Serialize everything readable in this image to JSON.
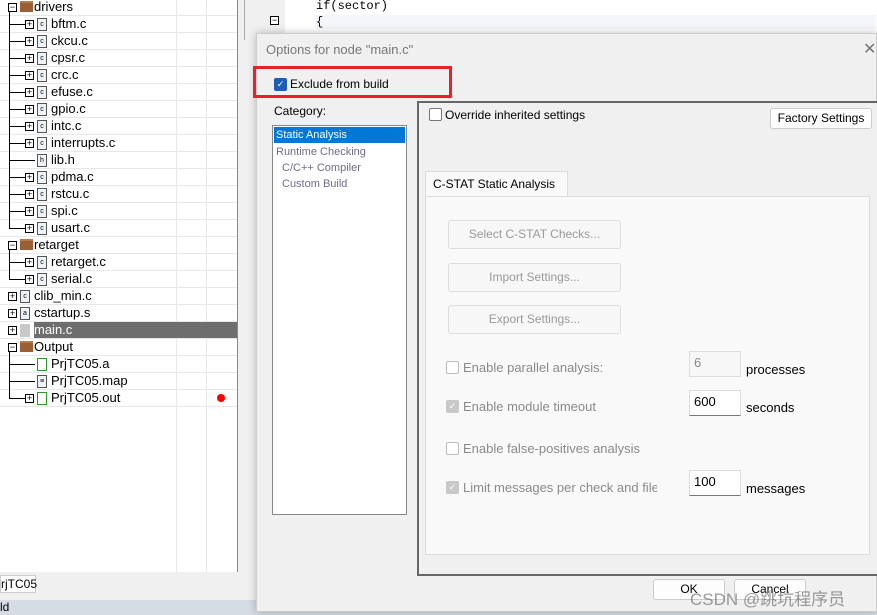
{
  "tree": {
    "items": [
      {
        "label": "drivers",
        "type": "folder",
        "level": 0,
        "expanded": true
      },
      {
        "label": "bftm.c",
        "type": "c",
        "level": 1
      },
      {
        "label": "ckcu.c",
        "type": "c",
        "level": 1
      },
      {
        "label": "cpsr.c",
        "type": "c",
        "level": 1
      },
      {
        "label": "crc.c",
        "type": "c",
        "level": 1
      },
      {
        "label": "efuse.c",
        "type": "c",
        "level": 1
      },
      {
        "label": "gpio.c",
        "type": "c",
        "level": 1
      },
      {
        "label": "intc.c",
        "type": "c",
        "level": 1
      },
      {
        "label": "interrupts.c",
        "type": "c",
        "level": 1
      },
      {
        "label": "lib.h",
        "type": "h",
        "level": 1
      },
      {
        "label": "pdma.c",
        "type": "c",
        "level": 1
      },
      {
        "label": "rstcu.c",
        "type": "c",
        "level": 1
      },
      {
        "label": "spi.c",
        "type": "c",
        "level": 1
      },
      {
        "label": "usart.c",
        "type": "c",
        "level": 1
      },
      {
        "label": "retarget",
        "type": "folder",
        "level": 0,
        "expanded": true
      },
      {
        "label": "retarget.c",
        "type": "c",
        "level": 1
      },
      {
        "label": "serial.c",
        "type": "c",
        "level": 1
      },
      {
        "label": "clib_min.c",
        "type": "c",
        "level": 0
      },
      {
        "label": "cstartup.s",
        "type": "s",
        "level": 0
      },
      {
        "label": "main.c",
        "type": "excluded",
        "level": 0,
        "selected": true
      },
      {
        "label": "Output",
        "type": "folder",
        "level": 0,
        "expanded": true
      },
      {
        "label": "PrjTC05.a",
        "type": "out",
        "level": 1
      },
      {
        "label": "PrjTC05.map",
        "type": "map",
        "level": 1
      },
      {
        "label": "PrjTC05.out",
        "type": "out",
        "level": 1,
        "status": "red-dot"
      }
    ],
    "tab": "rjTC05",
    "status_text": "ld"
  },
  "editor": {
    "lines": [
      "if(sector)",
      "{"
    ]
  },
  "dialog": {
    "title": "Options for node \"main.c\"",
    "exclude_label": "Exclude from build",
    "exclude_checked": true,
    "category_label": "Category:",
    "categories": [
      "Static Analysis",
      "Runtime Checking",
      "C/C++ Compiler",
      "Custom Build"
    ],
    "override_label": "Override inherited settings",
    "factory_label": "Factory Settings",
    "tab": "C-STAT Static Analysis",
    "select_checks": "Select C-STAT Checks...",
    "import": "Import Settings...",
    "export": "Export Settings...",
    "parallel_label": "Enable parallel analysis:",
    "parallel_value": "6",
    "parallel_unit": "processes",
    "timeout_label": "Enable module timeout",
    "timeout_value": "600",
    "timeout_unit": "seconds",
    "fp_label": "Enable false-positives analysis",
    "limit_label": "Limit messages per check and file",
    "limit_value": "100",
    "limit_unit": "messages",
    "ok": "OK",
    "cancel": "Cancel"
  },
  "highlight_color": "#e8202a",
  "watermark": "CSDN @跳坑程序员"
}
